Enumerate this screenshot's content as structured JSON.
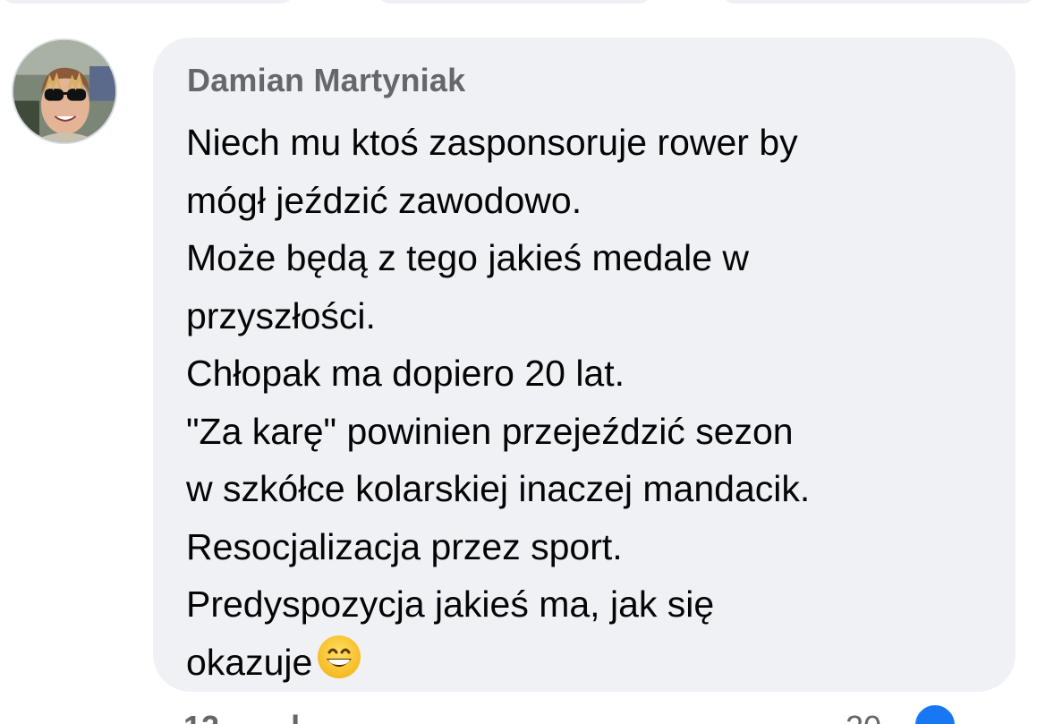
{
  "comment": {
    "author": "Damian Martyniak",
    "lines": [
      "Niech mu ktoś zasponsoruje rower by",
      "mógł jeździć zawodowo.",
      "Może będą z tego jakieś medale w",
      "przyszłości.",
      "Chłopak ma dopiero 20 lat.",
      "\"Za karę\" powinien przejeździć sezon",
      "w szkółce kolarskiej inaczej mandacik.",
      "Resocjalizacja przez sport.",
      "Predyspozycja jakieś ma, jak się",
      "okazuje"
    ],
    "emoji": "grinning-face-with-smiling-eyes"
  },
  "meta": {
    "time_partial": "12",
    "action_partial": "l",
    "reaction_count_partial": "20"
  },
  "icons": {
    "avatar": "user-avatar-photo",
    "reaction": "like-icon"
  },
  "colors": {
    "bubble": "#f0f1f5",
    "author": "#65676b",
    "text": "#050505",
    "like": "#1877f2"
  }
}
